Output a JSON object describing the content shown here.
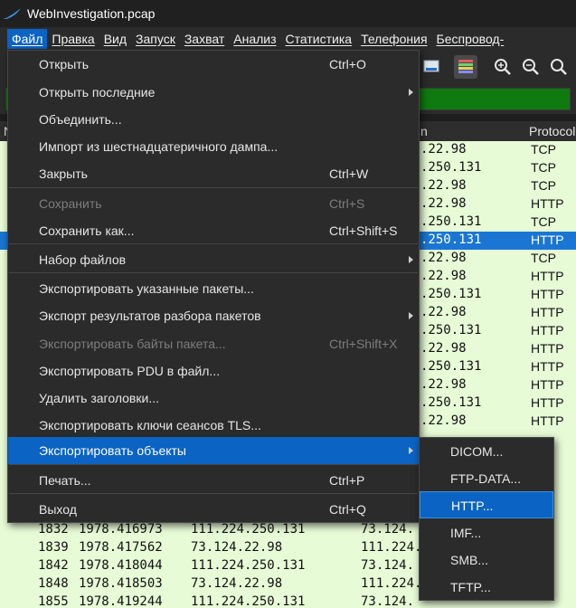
{
  "window": {
    "title": "WebInvestigation.pcap"
  },
  "menubar": [
    {
      "label": "Файл",
      "active": true
    },
    {
      "label": "Правка"
    },
    {
      "label": "Вид"
    },
    {
      "label": "Запуск"
    },
    {
      "label": "Захват"
    },
    {
      "label": "Анализ"
    },
    {
      "label": "Статистика"
    },
    {
      "label": "Телефония"
    },
    {
      "label": "Беспровод-"
    }
  ],
  "packet_list": {
    "headers": {
      "no": "N",
      "destination_partial": "n",
      "protocol": "Protocol"
    },
    "visible_rows": [
      {
        "dst": ".22.98",
        "proto": "TCP"
      },
      {
        "dst": ".250.131",
        "proto": "TCP"
      },
      {
        "dst": ".22.98",
        "proto": "TCP"
      },
      {
        "dst": ".22.98",
        "proto": "HTTP"
      },
      {
        "dst": ".250.131",
        "proto": "TCP"
      },
      {
        "dst": ".250.131",
        "proto": "HTTP",
        "selected": true
      },
      {
        "dst": ".22.98",
        "proto": "TCP"
      },
      {
        "dst": ".22.98",
        "proto": "HTTP"
      },
      {
        "dst": ".250.131",
        "proto": "HTTP"
      },
      {
        "dst": ".22.98",
        "proto": "HTTP"
      },
      {
        "dst": ".250.131",
        "proto": "HTTP"
      },
      {
        "dst": ".22.98",
        "proto": "HTTP"
      },
      {
        "dst": ".250.131",
        "proto": "HTTP"
      },
      {
        "dst": ".22.98",
        "proto": "HTTP"
      },
      {
        "dst": ".250.131",
        "proto": "HTTP"
      },
      {
        "dst": ".22.98",
        "proto": "HTTP"
      }
    ],
    "bottom_rows": [
      {
        "no": "1832",
        "time": "1978.416973",
        "src": "111.224.250.131",
        "dst": "73.124."
      },
      {
        "no": "1839",
        "time": "1978.417562",
        "src": "73.124.22.98",
        "dst": "111.224."
      },
      {
        "no": "1842",
        "time": "1978.418044",
        "src": "111.224.250.131",
        "dst": "73.124."
      },
      {
        "no": "1848",
        "time": "1978.418503",
        "src": "73.124.22.98",
        "dst": "111.224."
      },
      {
        "no": "1855",
        "time": "1978.419244",
        "src": "111.224.250.131",
        "dst": "73.124."
      }
    ]
  },
  "file_menu": {
    "items": [
      {
        "label": "Открыть",
        "shortcut": "Ctrl+O"
      },
      {
        "label": "Открыть последние",
        "submenu": true
      },
      {
        "label": "Объединить..."
      },
      {
        "label": "Импорт из шестнадцатеричного дампа..."
      },
      {
        "label": "Закрыть",
        "shortcut": "Ctrl+W"
      },
      {
        "label": "Сохранить",
        "shortcut": "Ctrl+S",
        "disabled": true
      },
      {
        "label": "Сохранить как...",
        "shortcut": "Ctrl+Shift+S"
      },
      {
        "label": "Набор файлов",
        "submenu": true
      },
      {
        "label": "Экспортировать указанные пакеты..."
      },
      {
        "label": "Экспорт результатов разбора пакетов",
        "submenu": true
      },
      {
        "label": "Экспортировать байты пакета...",
        "shortcut": "Ctrl+Shift+X",
        "disabled": true
      },
      {
        "label": "Экспортировать PDU в файл..."
      },
      {
        "label": "Удалить заголовки..."
      },
      {
        "label": "Экспортировать ключи сеансов TLS..."
      },
      {
        "label": "Экспортировать объекты",
        "submenu": true,
        "highlighted": true
      },
      {
        "label": "Печать...",
        "shortcut": "Ctrl+P"
      },
      {
        "label": "Выход",
        "shortcut": "Ctrl+Q"
      }
    ]
  },
  "export_objects_submenu": {
    "items": [
      {
        "label": "DICOM..."
      },
      {
        "label": "FTP-DATA..."
      },
      {
        "label": "HTTP...",
        "highlighted": true
      },
      {
        "label": "IMF..."
      },
      {
        "label": "SMB..."
      },
      {
        "label": "TFTP..."
      }
    ]
  },
  "colors": {
    "accent": "#0b63c3",
    "packet_bg": "#e7fbd7",
    "filter_valid": "#0f7a0f",
    "menu_bg": "#2b2b2b"
  }
}
